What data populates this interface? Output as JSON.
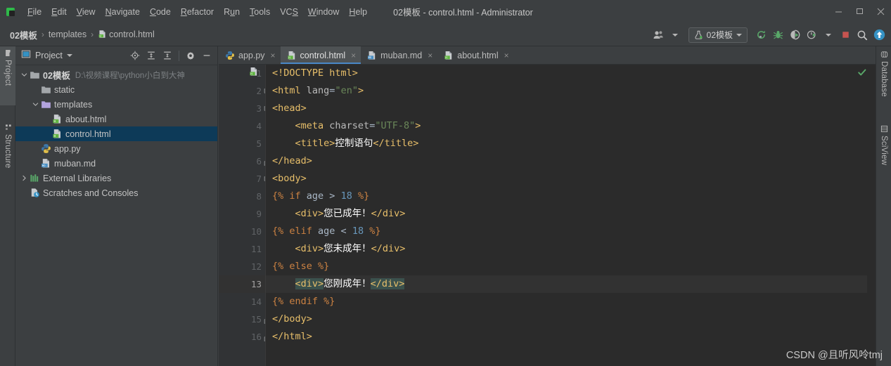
{
  "window": {
    "title": "02模板 - control.html - Administrator",
    "minimize_label": "minimize",
    "maximize_label": "maximize",
    "close_label": "close"
  },
  "menubar": {
    "logo": "pycharm-logo-icon",
    "items": [
      {
        "label": "File",
        "mnemonic": "F"
      },
      {
        "label": "Edit",
        "mnemonic": "E"
      },
      {
        "label": "View",
        "mnemonic": "V"
      },
      {
        "label": "Navigate",
        "mnemonic": "N"
      },
      {
        "label": "Code",
        "mnemonic": "C"
      },
      {
        "label": "Refactor",
        "mnemonic": "R"
      },
      {
        "label": "Run",
        "mnemonic": "u"
      },
      {
        "label": "Tools",
        "mnemonic": "T"
      },
      {
        "label": "VCS",
        "mnemonic": "S"
      },
      {
        "label": "Window",
        "mnemonic": "W"
      },
      {
        "label": "Help",
        "mnemonic": "H"
      }
    ]
  },
  "navbar": {
    "breadcrumbs": [
      {
        "label": "02模板",
        "icon": ""
      },
      {
        "label": "templates",
        "icon": ""
      },
      {
        "label": "control.html",
        "icon": "html-file-icon"
      }
    ],
    "separator": "›",
    "run_config": {
      "label": "02模板",
      "icon": "flask-run-config-icon",
      "dropdown": "chevron-down-icon"
    },
    "buttons": [
      {
        "name": "user-switch-button",
        "icon": "people-icon"
      },
      {
        "name": "rerun-button",
        "icon": "rerun-icon"
      },
      {
        "name": "debug-button",
        "icon": "bug-icon"
      },
      {
        "name": "run-with-coverage-button",
        "icon": "coverage-icon"
      },
      {
        "name": "profile-button",
        "icon": "profile-icon"
      },
      {
        "name": "stop-button",
        "icon": "stop-square-icon"
      },
      {
        "name": "search-everywhere-button",
        "icon": "magnifier-icon"
      },
      {
        "name": "update-project-button",
        "icon": "arrow-up-circle-icon"
      }
    ]
  },
  "left_strip": {
    "tabs": [
      {
        "label": "Project",
        "icon": "folder-icon",
        "active": true
      },
      {
        "label": "Structure",
        "icon": "structure-icon",
        "active": false
      }
    ]
  },
  "right_strip": {
    "tabs": [
      {
        "label": "Database",
        "icon": "database-icon"
      },
      {
        "label": "SciView",
        "icon": "grid-icon"
      }
    ]
  },
  "project_panel": {
    "title": "Project",
    "title_dropdown": "chevron-down-icon",
    "tools": [
      {
        "name": "scroll-from-source-button",
        "icon": "target-icon"
      },
      {
        "name": "expand-all-button",
        "icon": "expand-all-icon"
      },
      {
        "name": "collapse-all-button",
        "icon": "collapse-all-icon"
      },
      {
        "name": "settings-button",
        "icon": "gear-icon"
      },
      {
        "name": "hide-button",
        "icon": "minus-icon"
      }
    ],
    "tree": [
      {
        "label": "02模板",
        "path": "D:\\视频课程\\python小白到大神",
        "icon": "folder-icon",
        "indent": 0,
        "arrow": "expanded",
        "bold": true,
        "selected": false
      },
      {
        "label": "static",
        "path": "",
        "icon": "folder-icon",
        "indent": 1,
        "arrow": "none",
        "bold": false,
        "selected": false
      },
      {
        "label": "templates",
        "path": "",
        "icon": "folder-templates-icon",
        "indent": 1,
        "arrow": "expanded",
        "bold": false,
        "selected": false
      },
      {
        "label": "about.html",
        "path": "",
        "icon": "html-file-icon",
        "indent": 2,
        "arrow": "none",
        "bold": false,
        "selected": false
      },
      {
        "label": "control.html",
        "path": "",
        "icon": "html-file-icon",
        "indent": 2,
        "arrow": "none",
        "bold": false,
        "selected": true
      },
      {
        "label": "app.py",
        "path": "",
        "icon": "python-file-icon",
        "indent": 1,
        "arrow": "none",
        "bold": false,
        "selected": false
      },
      {
        "label": "muban.md",
        "path": "",
        "icon": "markdown-file-icon",
        "indent": 1,
        "arrow": "none",
        "bold": false,
        "selected": false
      },
      {
        "label": "External Libraries",
        "path": "",
        "icon": "libraries-icon",
        "indent": 0,
        "arrow": "collapsed",
        "bold": false,
        "selected": false
      },
      {
        "label": "Scratches and Consoles",
        "path": "",
        "icon": "scratches-icon",
        "indent": 0,
        "arrow": "none",
        "bold": false,
        "selected": false
      }
    ]
  },
  "editor": {
    "tabs": [
      {
        "label": "app.py",
        "icon": "python-file-icon",
        "active": false,
        "close": "×"
      },
      {
        "label": "control.html",
        "icon": "html-file-icon",
        "active": true,
        "close": "×"
      },
      {
        "label": "muban.md",
        "icon": "markdown-file-icon",
        "active": false,
        "close": "×"
      },
      {
        "label": "about.html",
        "icon": "html-file-icon",
        "active": false,
        "close": "×"
      }
    ],
    "inspection_status": "ok-check-icon",
    "current_line": 13,
    "file_type_icon": "html-file-icon",
    "lines": [
      {
        "n": 1,
        "fold": "none",
        "tokens": [
          {
            "t": "<!DOCTYPE html>",
            "c": "tk-tag"
          }
        ]
      },
      {
        "n": 2,
        "fold": "start",
        "tokens": [
          {
            "t": "<html ",
            "c": "tk-tag"
          },
          {
            "t": "lang",
            "c": "tk-attr"
          },
          {
            "t": "=",
            "c": "tk-op"
          },
          {
            "t": "\"en\"",
            "c": "tk-str"
          },
          {
            "t": ">",
            "c": "tk-tag"
          }
        ]
      },
      {
        "n": 3,
        "fold": "start",
        "tokens": [
          {
            "t": "<head>",
            "c": "tk-tag"
          }
        ]
      },
      {
        "n": 4,
        "fold": "none",
        "tokens": [
          {
            "t": "    <meta ",
            "c": "tk-tag"
          },
          {
            "t": "charset",
            "c": "tk-attr"
          },
          {
            "t": "=",
            "c": "tk-op"
          },
          {
            "t": "\"UTF-8\"",
            "c": "tk-str"
          },
          {
            "t": ">",
            "c": "tk-tag"
          }
        ]
      },
      {
        "n": 5,
        "fold": "none",
        "tokens": [
          {
            "t": "    <title>",
            "c": "tk-tag"
          },
          {
            "t": "控制语句",
            "c": "tk-txt"
          },
          {
            "t": "</title>",
            "c": "tk-tag"
          }
        ]
      },
      {
        "n": 6,
        "fold": "end",
        "tokens": [
          {
            "t": "</head>",
            "c": "tk-tag"
          }
        ]
      },
      {
        "n": 7,
        "fold": "start",
        "tokens": [
          {
            "t": "<body>",
            "c": "tk-tag"
          }
        ]
      },
      {
        "n": 8,
        "fold": "none",
        "tokens": [
          {
            "t": "{% ",
            "c": "tk-jin"
          },
          {
            "t": "if",
            "c": "tk-kw"
          },
          {
            "t": " age ",
            "c": "tk-op"
          },
          {
            "t": ">",
            "c": "tk-op"
          },
          {
            "t": " ",
            "c": "tk-op"
          },
          {
            "t": "18",
            "c": "tk-num"
          },
          {
            "t": " %}",
            "c": "tk-jin"
          }
        ]
      },
      {
        "n": 9,
        "fold": "none",
        "tokens": [
          {
            "t": "    <div>",
            "c": "tk-tag"
          },
          {
            "t": "您已成年！",
            "c": "tk-txt"
          },
          {
            "t": "</div>",
            "c": "tk-tag"
          }
        ]
      },
      {
        "n": 10,
        "fold": "none",
        "tokens": [
          {
            "t": "{% ",
            "c": "tk-jin"
          },
          {
            "t": "elif",
            "c": "tk-kw"
          },
          {
            "t": " age ",
            "c": "tk-op"
          },
          {
            "t": "<",
            "c": "tk-op"
          },
          {
            "t": " ",
            "c": "tk-op"
          },
          {
            "t": "18",
            "c": "tk-num"
          },
          {
            "t": " %}",
            "c": "tk-jin"
          }
        ]
      },
      {
        "n": 11,
        "fold": "none",
        "tokens": [
          {
            "t": "    <div>",
            "c": "tk-tag"
          },
          {
            "t": "您未成年！",
            "c": "tk-txt"
          },
          {
            "t": "</div>",
            "c": "tk-tag"
          }
        ]
      },
      {
        "n": 12,
        "fold": "none",
        "tokens": [
          {
            "t": "{% ",
            "c": "tk-jin"
          },
          {
            "t": "else",
            "c": "tk-kw"
          },
          {
            "t": " %}",
            "c": "tk-jin"
          }
        ]
      },
      {
        "n": 13,
        "fold": "none",
        "tokens": [
          {
            "t": "    ",
            "c": "tk-op"
          },
          {
            "t": "<div>",
            "c": "tk-tag hl"
          },
          {
            "t": "您刚成年！",
            "c": "tk-txt"
          },
          {
            "t": "CARET",
            "c": "caret"
          },
          {
            "t": "</div>",
            "c": "tk-tag hl"
          }
        ]
      },
      {
        "n": 14,
        "fold": "none",
        "tokens": [
          {
            "t": "{% ",
            "c": "tk-jin"
          },
          {
            "t": "endif",
            "c": "tk-kw"
          },
          {
            "t": " %}",
            "c": "tk-jin"
          }
        ]
      },
      {
        "n": 15,
        "fold": "end",
        "tokens": [
          {
            "t": "</body>",
            "c": "tk-tag"
          }
        ]
      },
      {
        "n": 16,
        "fold": "end",
        "tokens": [
          {
            "t": "</html>",
            "c": "tk-tag"
          }
        ]
      }
    ]
  },
  "watermark": "CSDN @且听风呤tmj",
  "colors": {
    "chrome_bg": "#3c3f41",
    "editor_bg": "#2b2b2b",
    "gutter_bg": "#313335",
    "selection_tree": "#0d3a58",
    "tag": "#e8bf6a",
    "string": "#6a8759",
    "jinja": "#cc8242",
    "number": "#6897bb",
    "tab_underline": "#4a88c7",
    "match_highlight": "#3b514d"
  }
}
